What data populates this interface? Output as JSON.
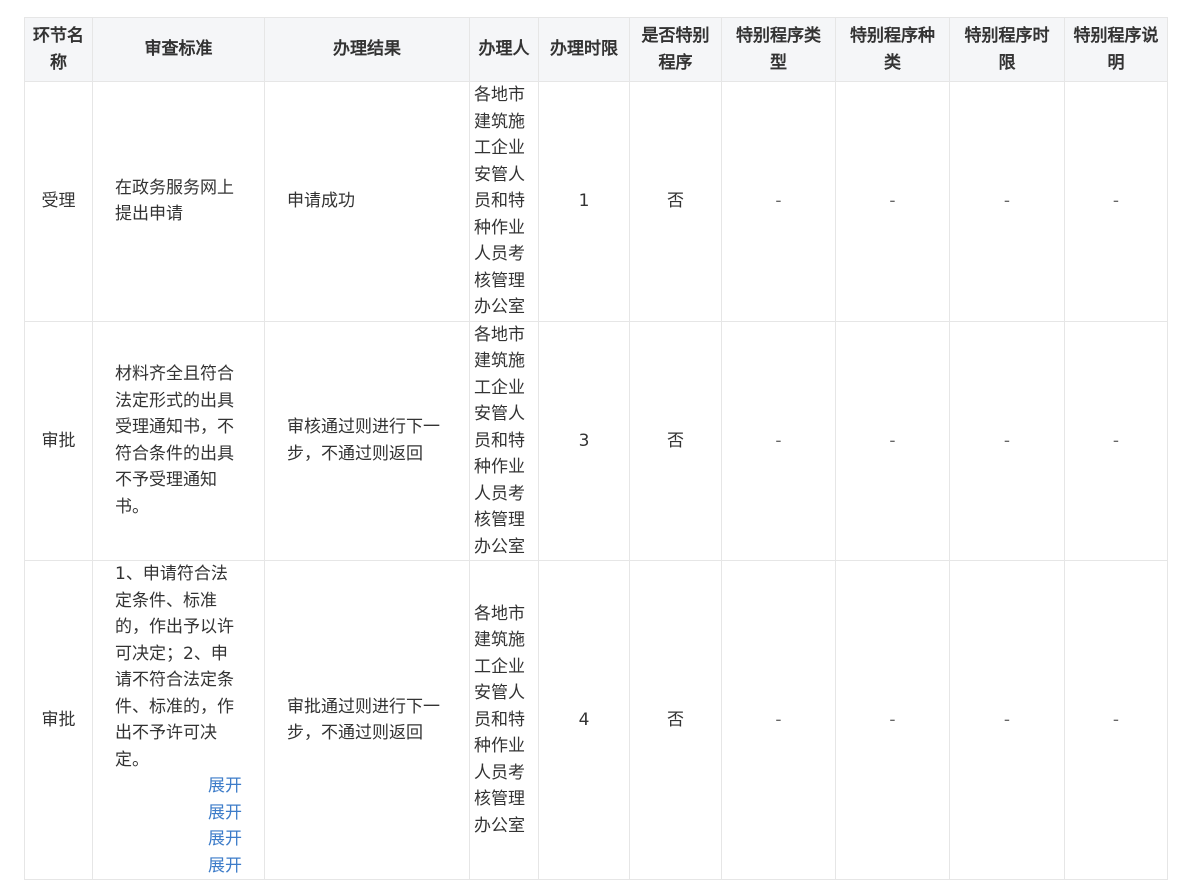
{
  "headers": [
    "环节名称",
    "审查标准",
    "办理结果",
    "办理人",
    "办理时限",
    "是否特别程序",
    "特别程序类型",
    "特别程序种类",
    "特别程序时限",
    "特别程序说明"
  ],
  "rows": [
    {
      "stage": "受理",
      "criteria": "在政务服务网上提出申请",
      "result": "申请成功",
      "handler": "各地市建筑施工企业安管人员和特种作业人员考核管理办公室",
      "time_limit": "1",
      "special": "否",
      "special_type": "-",
      "special_kind": "-",
      "special_limit": "-",
      "special_note": "-"
    },
    {
      "stage": "审批",
      "criteria": "材料齐全且符合法定形式的出具受理通知书，不符合条件的出具不予受理通知书。",
      "result": "审核通过则进行下一步，不通过则返回",
      "handler": "各地市建筑施工企业安管人员和特种作业人员考核管理办公室",
      "time_limit": "3",
      "special": "否",
      "special_type": "-",
      "special_kind": "-",
      "special_limit": "-",
      "special_note": "-"
    },
    {
      "stage": "审批",
      "criteria": "1、申请符合法定条件、标准的，作出予以许可决定；2、申请不符合法定条件、标准的，作出不予许可决定。",
      "expand_links": [
        "展开",
        "展开",
        "展开",
        "展开"
      ],
      "result": "审批通过则进行下一步，不通过则返回",
      "handler": "各地市建筑施工企业安管人员和特种作业人员考核管理办公室",
      "time_limit": "4",
      "special": "否",
      "special_type": "-",
      "special_kind": "-",
      "special_limit": "-",
      "special_note": "-"
    }
  ]
}
